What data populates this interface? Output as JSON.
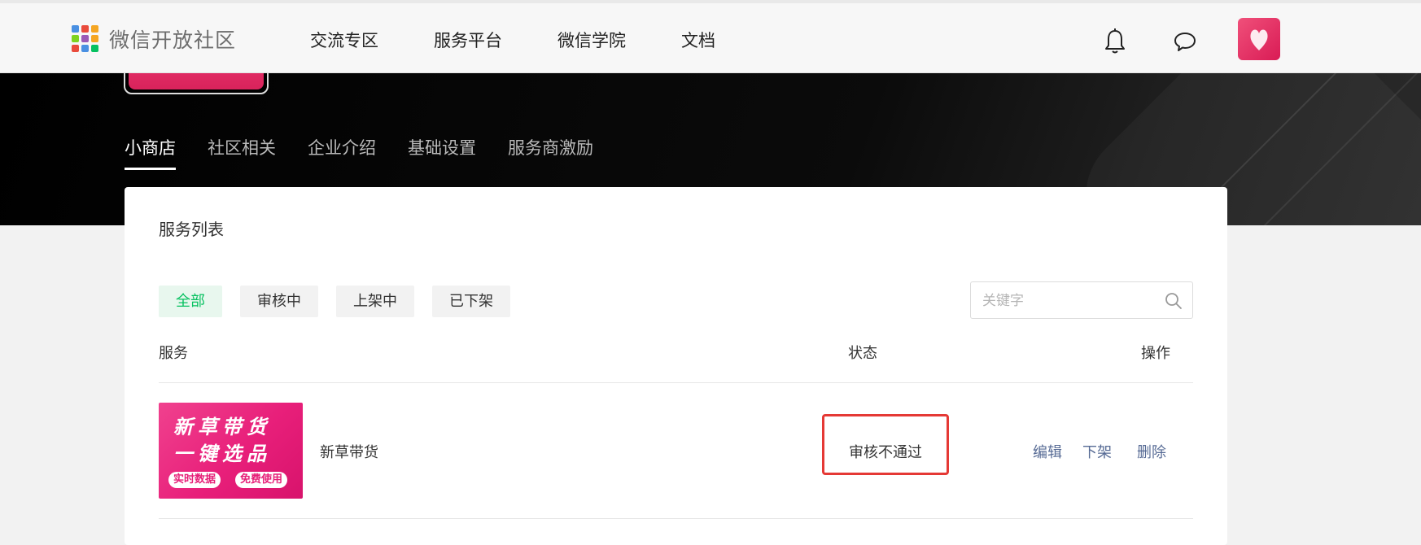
{
  "header": {
    "logo_text": "微信开放社区",
    "nav": [
      "交流专区",
      "服务平台",
      "微信学院",
      "文档"
    ],
    "icons": [
      "bell-icon",
      "chat-icon",
      "avatar"
    ]
  },
  "banner": {
    "tabs": [
      "小商店",
      "社区相关",
      "企业介绍",
      "基础设置",
      "服务商激励"
    ],
    "active_tab": "小商店"
  },
  "panel": {
    "title": "服务列表",
    "filters": [
      "全部",
      "审核中",
      "上架中",
      "已下架"
    ],
    "active_filter": "全部",
    "search": {
      "placeholder": "关键字",
      "value": ""
    },
    "columns": {
      "service": "服务",
      "status": "状态",
      "action": "操作"
    },
    "rows": [
      {
        "thumb_line1": "新草带货",
        "thumb_line2": "一键选品",
        "thumb_tag1": "实时数据",
        "thumb_tag2": "免费使用",
        "name": "新草带货",
        "status": "审核不通过",
        "actions": [
          "编辑",
          "下架",
          "删除"
        ]
      }
    ]
  },
  "colors": {
    "accent_green": "#07c160",
    "link": "#576b95",
    "highlight_box": "#e53935",
    "brand_pink": "#e8336d"
  }
}
